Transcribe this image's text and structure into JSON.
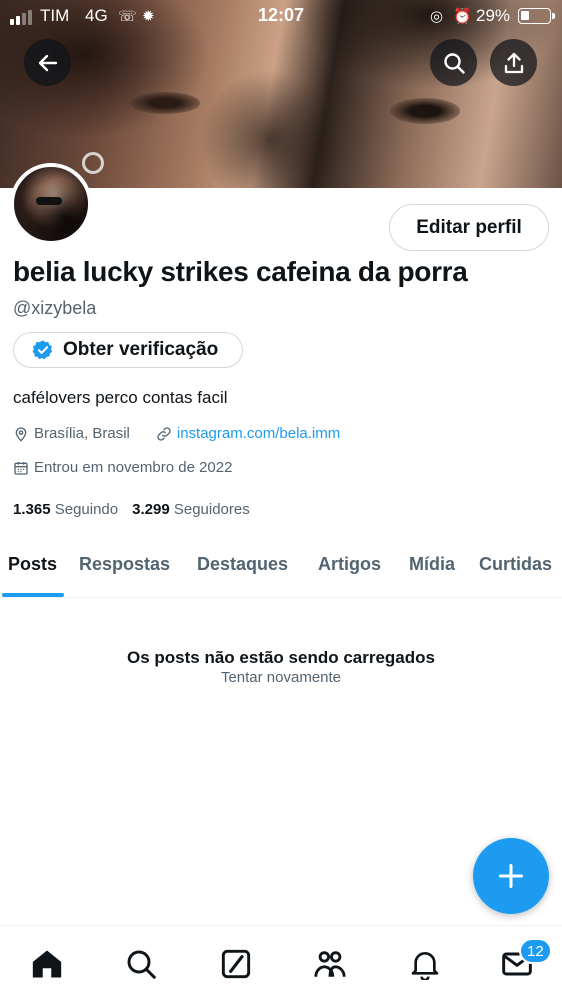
{
  "status_bar": {
    "carrier": "TIM",
    "network": "4G",
    "time": "12:07",
    "battery_percent": "29%",
    "battery_level": 0.29
  },
  "header": {
    "back_icon": "arrow-left-icon",
    "search_icon": "search-icon",
    "share_icon": "share-icon"
  },
  "profile": {
    "edit_button": "Editar perfil",
    "display_name": "belia lucky strikes cafeina da porra",
    "handle": "@xizybela",
    "verify_button": "Obter verificação",
    "bio": "cafélovers perco contas facil",
    "location": "Brasília, Brasil",
    "link": "instagram.com/bela.imm",
    "joined": "Entrou em novembro de 2022",
    "following_count": "1.365",
    "following_label": "Seguindo",
    "followers_count": "3.299",
    "followers_label": "Seguidores"
  },
  "tabs": [
    {
      "label": "Posts",
      "active": true
    },
    {
      "label": "Respostas"
    },
    {
      "label": "Destaques"
    },
    {
      "label": "Artigos"
    },
    {
      "label": "Mídia"
    },
    {
      "label": "Curtidas"
    }
  ],
  "empty_state": {
    "title": "Os posts não estão sendo carregados",
    "retry": "Tentar novamente"
  },
  "bottom_nav": {
    "items": [
      "home-icon",
      "search-icon",
      "grok-icon",
      "communities-icon",
      "notifications-icon",
      "messages-icon"
    ],
    "messages_badge": "12"
  },
  "colors": {
    "accent": "#1d9bf0",
    "text_primary": "#0f1419",
    "text_secondary": "#536471"
  }
}
